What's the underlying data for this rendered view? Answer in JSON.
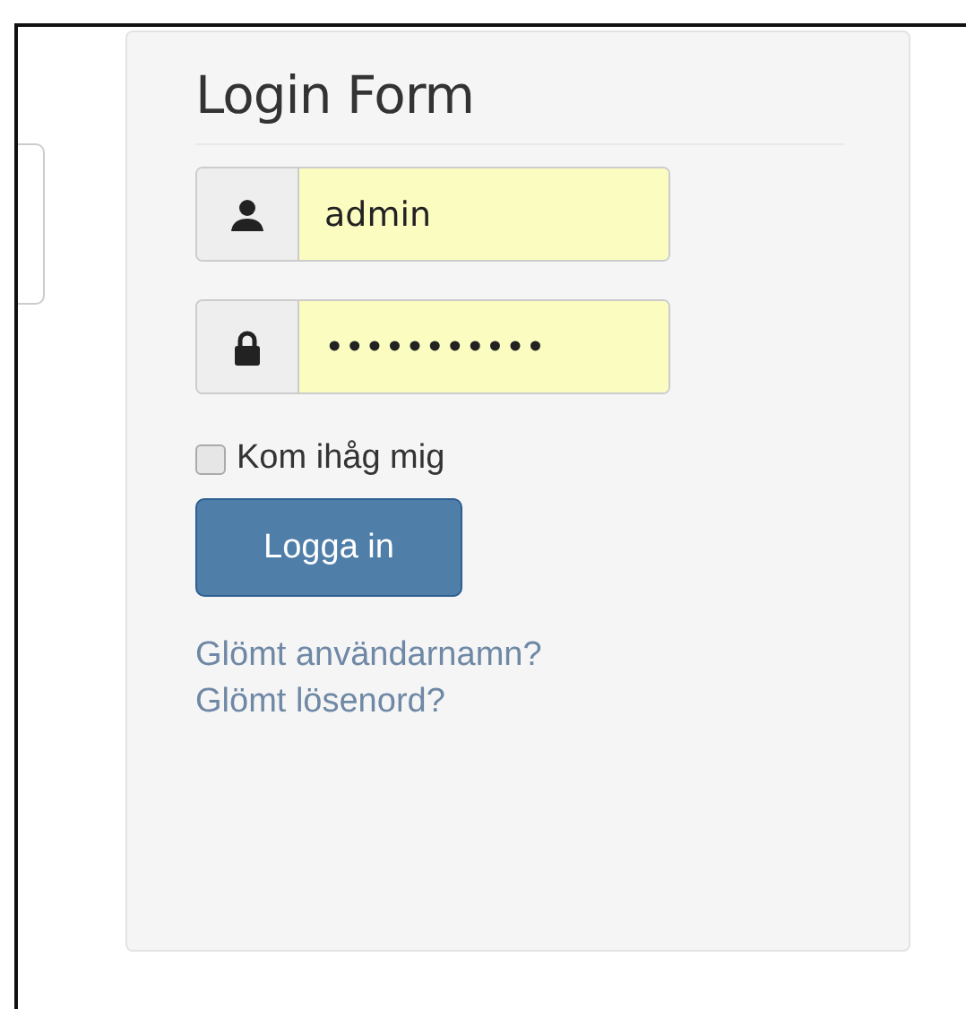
{
  "form": {
    "title": "Login Form",
    "fields": [
      {
        "kind": "user",
        "value": "admin"
      },
      {
        "kind": "password",
        "value": "•••••••••••"
      }
    ],
    "remember": {
      "label": "Kom ihåg mig",
      "checked": false
    },
    "submit": "Logga in",
    "links": [
      "Glömt användarnamn?",
      "Glömt lösenord?"
    ]
  }
}
